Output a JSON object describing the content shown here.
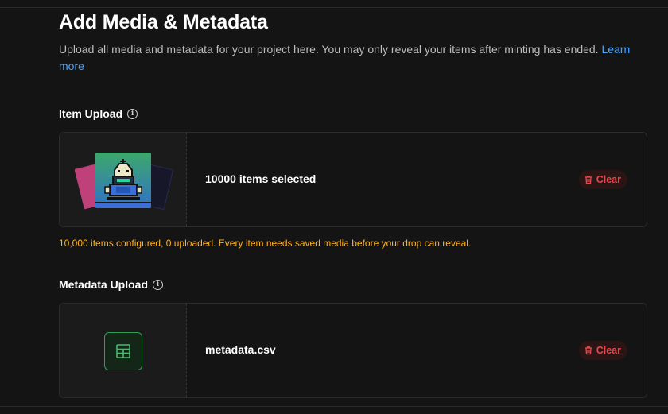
{
  "header": {
    "title": "Add Media & Metadata",
    "description": "Upload all media and metadata for your project here. You may only reveal your items after minting has ended.",
    "learn_more": "Learn more"
  },
  "item_upload": {
    "label": "Item Upload",
    "info_icon": "info-icon",
    "selected_text": "10000 items selected",
    "clear_label": "Clear",
    "warning": "10,000 items configured, 0 uploaded. Every item needs saved media before your drop can reveal."
  },
  "metadata_upload": {
    "label": "Metadata Upload",
    "info_icon": "info-icon",
    "file_name": "metadata.csv",
    "clear_label": "Clear",
    "file_icon": "table-icon"
  },
  "colors": {
    "background": "#141414",
    "link": "#4aa4ff",
    "warning": "#ffb224",
    "danger": "#e5484d",
    "csv_accent": "#2f9e54"
  }
}
